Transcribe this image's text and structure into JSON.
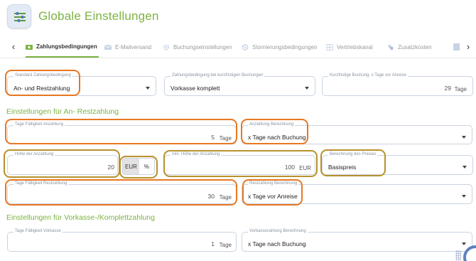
{
  "header": {
    "title": "Globale Einstellungen"
  },
  "tabs": [
    {
      "label": "Zahlungsbedingungen",
      "icon": "money-icon",
      "active": true
    },
    {
      "label": "E-Mailversand",
      "icon": "mail-icon",
      "active": false
    },
    {
      "label": "Buchungseinstellungen",
      "icon": "gear-icon",
      "active": false
    },
    {
      "label": "Stornierungsbedingungen",
      "icon": "cancel-icon",
      "active": false
    },
    {
      "label": "Vertriebskanal",
      "icon": "grid-icon",
      "active": false
    },
    {
      "label": "Zusatzkosten",
      "icon": "cost-icon",
      "active": false
    }
  ],
  "general": {
    "standard": {
      "label": "Standard Zahlungsbedingung",
      "value": "An- und Restzahlung"
    },
    "short_term": {
      "label": "Zahlungsbedingung bei kurzfristigen Buchungen",
      "value": "Vorkasse komplett"
    },
    "short_days": {
      "label": "Kurzfristige Buchung: x Tage vor Anreise",
      "value": "29",
      "unit": "Tage"
    }
  },
  "section_an_rest": {
    "title": "Einstellungen für An- Restzahlung",
    "due_days": {
      "label": "Tage Fälligkeit Anzahlung",
      "value": "5",
      "unit": "Tage"
    },
    "deposit_calc": {
      "label": "Anzahlung Berechnung",
      "value": "x Tage nach Buchung"
    },
    "deposit_amount": {
      "label": "Höhe der Anzahlung",
      "value": "20"
    },
    "currency_toggle": {
      "options": [
        "EUR",
        "%"
      ],
      "selected": "EUR"
    },
    "min_deposit": {
      "label": "min. Höhe der Anzahlung",
      "value": "100",
      "unit": "EUR"
    },
    "price_basis": {
      "label": "Berechnung des Preises",
      "value": "Basispreis"
    },
    "rest_days": {
      "label": "Tage Fälligkeit Restzahlung",
      "value": "30",
      "unit": "Tage"
    },
    "rest_calc": {
      "label": "Restzahlung Berechnung",
      "value": "x Tage vor Anreise"
    }
  },
  "section_vorkasse": {
    "title": "Einstellungen für Vorkasse-/Komplettzahlung",
    "due_days": {
      "label": "Tage Fälligkeit Vorkasse",
      "value": "1",
      "unit": "Tage"
    },
    "calc": {
      "label": "Vorkassezahlung Berechnung",
      "value": "x Tage nach Buchung"
    }
  },
  "colors": {
    "accent": "#7cb342",
    "highlight_orange": "#e87722",
    "highlight_gold": "#b8912c"
  }
}
